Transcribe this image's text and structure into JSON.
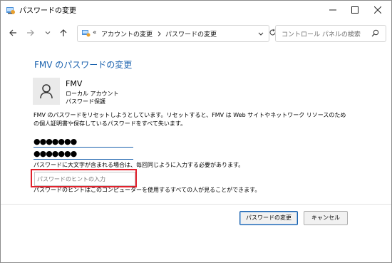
{
  "window": {
    "title": "パスワードの変更",
    "icons": {
      "app": "control-panel-icon",
      "minimize": "minimize-icon",
      "maximize": "maximize-icon",
      "close": "close-icon"
    }
  },
  "address_bar": {
    "nav": {
      "back": "back-arrow-icon",
      "forward": "forward-arrow-icon",
      "recent": "chevron-down-icon",
      "up": "up-arrow-icon"
    },
    "overflow": "«",
    "breadcrumbs": [
      "アカウントの変更",
      "パスワードの変更"
    ],
    "search_placeholder": "コントロール パネルの検索"
  },
  "main": {
    "heading": "FMV のパスワードの変更",
    "user": {
      "name": "FMV",
      "type": "ローカル アカウント",
      "protection": "パスワード保護"
    },
    "description": "FMV のパスワードをリセットしようとしています。リセットすると、FMV は Web サイトやネットワーク リソースのための個人証明書や保存しているパスワードをすべて失います。",
    "new_password_mask": "●●●●●●●",
    "confirm_password_mask": "●●●●●●●",
    "caps_note": "パスワードに大文字が含まれる場合は、毎回同じように入力する必要があります。",
    "hint_placeholder": "パスワードのヒントの入力",
    "hint_note": "パスワードのヒントはこのコンピューターを使用するすべての人が見ることができます。"
  },
  "buttons": {
    "change": "パスワードの変更",
    "cancel": "キャンセル"
  },
  "colors": {
    "accent": "#1b62ae",
    "highlight": "#e2212c"
  }
}
